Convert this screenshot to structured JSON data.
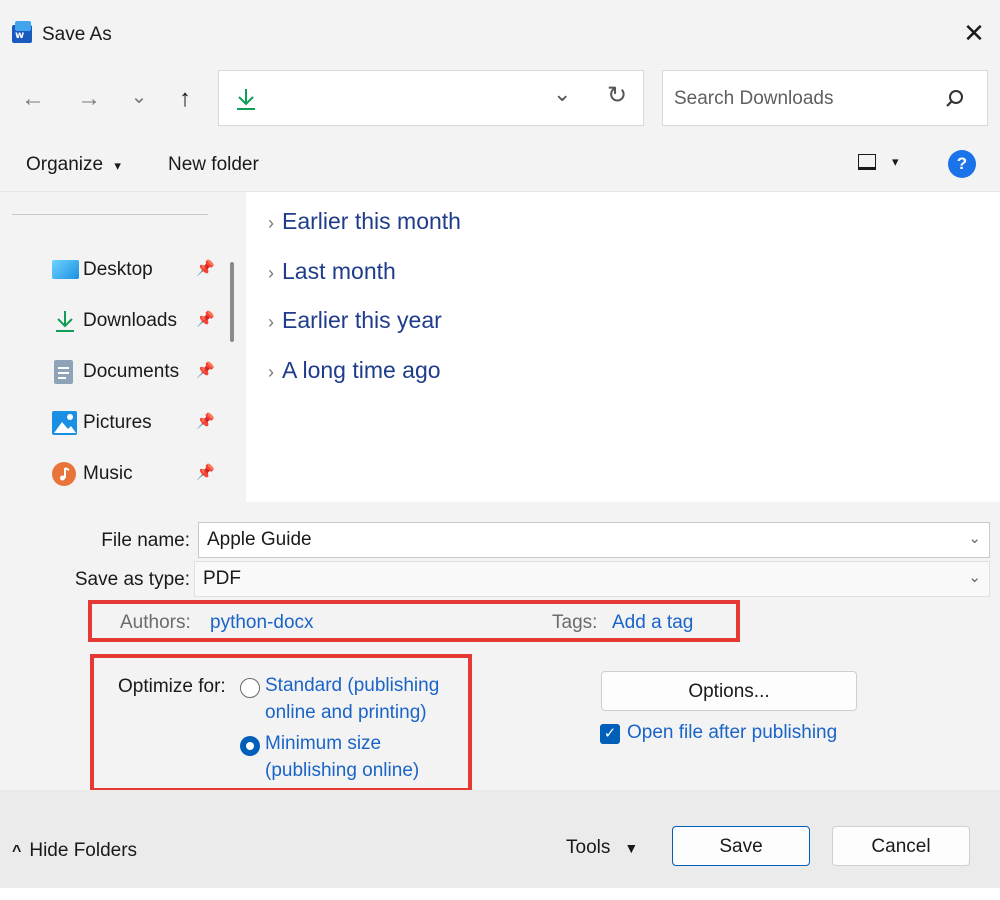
{
  "window": {
    "title": "Save As",
    "app_icon": "word-icon",
    "close_glyph": "✕"
  },
  "nav": {
    "back_glyph": "←",
    "forward_glyph": "→",
    "recent_glyph": "⌄",
    "up_glyph": "↑",
    "address_icon": "download-arrow-icon",
    "address_dropdown_glyph": "⌄",
    "refresh_glyph": "↻",
    "search_placeholder": "Search Downloads",
    "search_icon": "magnifier-icon"
  },
  "toolbar": {
    "organize": "Organize",
    "organize_caret": "▾",
    "new_folder": "New folder",
    "view_caret": "▾",
    "help": "?"
  },
  "sidebar": {
    "items": [
      {
        "label": "Desktop",
        "icon": "desktop-icon",
        "pinned": true
      },
      {
        "label": "Downloads",
        "icon": "downloads-icon",
        "pinned": true
      },
      {
        "label": "Documents",
        "icon": "documents-icon",
        "pinned": true
      },
      {
        "label": "Pictures",
        "icon": "pictures-icon",
        "pinned": true
      },
      {
        "label": "Music",
        "icon": "music-icon",
        "pinned": true
      }
    ],
    "pin_glyph": "📌"
  },
  "groups": [
    {
      "label": "Earlier this month"
    },
    {
      "label": "Last month"
    },
    {
      "label": "Earlier this year"
    },
    {
      "label": "A long time ago"
    }
  ],
  "group_chevron": "›",
  "form": {
    "file_name_label": "File name:",
    "file_name_value": "Apple Guide",
    "save_type_label": "Save as type:",
    "save_type_value": "PDF",
    "dropdown_glyph": "⌄",
    "authors_label": "Authors:",
    "authors_value": "python-docx",
    "tags_label": "Tags:",
    "tags_value": "Add a tag",
    "optimize_label": "Optimize for:",
    "optimize_standard_line1": "Standard (publishing",
    "optimize_standard_line2": "online and printing)",
    "optimize_minimum_line1": "Minimum size",
    "optimize_minimum_line2": "(publishing online)",
    "optimize_selected": "Minimum size (publishing online)",
    "options_button": "Options...",
    "open_after_label": "Open file after publishing",
    "open_after_checked": true
  },
  "footer": {
    "hide_folders_caret": "^",
    "hide_folders": "Hide Folders",
    "tools": "Tools",
    "tools_caret": "▼",
    "save": "Save",
    "cancel": "Cancel"
  },
  "colors": {
    "accent": "#005fb8",
    "link": "#1a64c8",
    "group_header": "#1f3c8a",
    "highlight_box": "#e53935"
  }
}
